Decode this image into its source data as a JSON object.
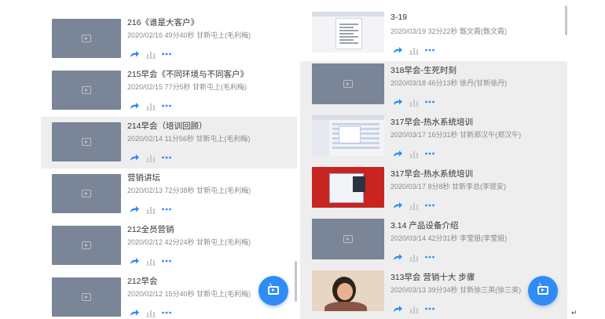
{
  "left_items": [
    {
      "title": "216《谁是大客户》",
      "meta": "2020/02/16 49分40秒 甘新屯上(毛利梅)",
      "highlight": false
    },
    {
      "title": "215早会《不同环境与不同客户》",
      "meta": "2020/02/15 77分5秒 甘新屯上(毛利梅)",
      "highlight": false
    },
    {
      "title": "214早会（培训回顾）",
      "meta": "2020/02/14 11分56秒 甘新屯上(毛利梅)",
      "highlight": true
    },
    {
      "title": "营销讲坛",
      "meta": "2020/02/13 72分38秒 甘新屯上(毛利梅)",
      "highlight": false
    },
    {
      "title": "212全员营销",
      "meta": "2020/02/12 42分24秒 甘新屯上(毛利梅)",
      "highlight": false
    },
    {
      "title": "212早会",
      "meta": "2020/02/12 15分40秒 甘新屯上(毛利梅)",
      "highlight": false
    }
  ],
  "right_items": [
    {
      "title": "3-19",
      "meta": "2020/03/19 32分22秒 甄文霞(甄文霞)",
      "highlight": false,
      "thumb": "doc"
    },
    {
      "title": "318早会-生死时刻",
      "meta": "2020/03/18 46分13秒 徐丹(甘新徐丹)",
      "highlight": true,
      "thumb": "blank"
    },
    {
      "title": "317早会-热水系统培训",
      "meta": "2020/03/17 16分31秒 甘新郑汉午(郑汉午)",
      "highlight": true,
      "thumb": "screen"
    },
    {
      "title": "317早会-热水系统培训",
      "meta": "2020/03/17 8分8秒 甘新李总(李珉安)",
      "highlight": true,
      "thumb": "red"
    },
    {
      "title": "3.14 产品设备介绍",
      "meta": "2020/03/14 42分31秒 李莹姐(李莹姐)",
      "highlight": true,
      "thumb": "blank"
    },
    {
      "title": "313早会 营销十大 步骤",
      "meta": "2020/03/13 39分34秒 甘新徐三英(徐三英)",
      "highlight": true,
      "thumb": "person"
    }
  ],
  "colors": {
    "fab": "#2f8cf5",
    "action_icon": "#2f8cf5",
    "thumb": "#7a8598",
    "highlight_row": "#eeeeee"
  },
  "icons": {
    "share": "share-icon",
    "stats": "bar-chart-icon",
    "more": "more-dots-icon",
    "fab": "live-tv-icon"
  }
}
